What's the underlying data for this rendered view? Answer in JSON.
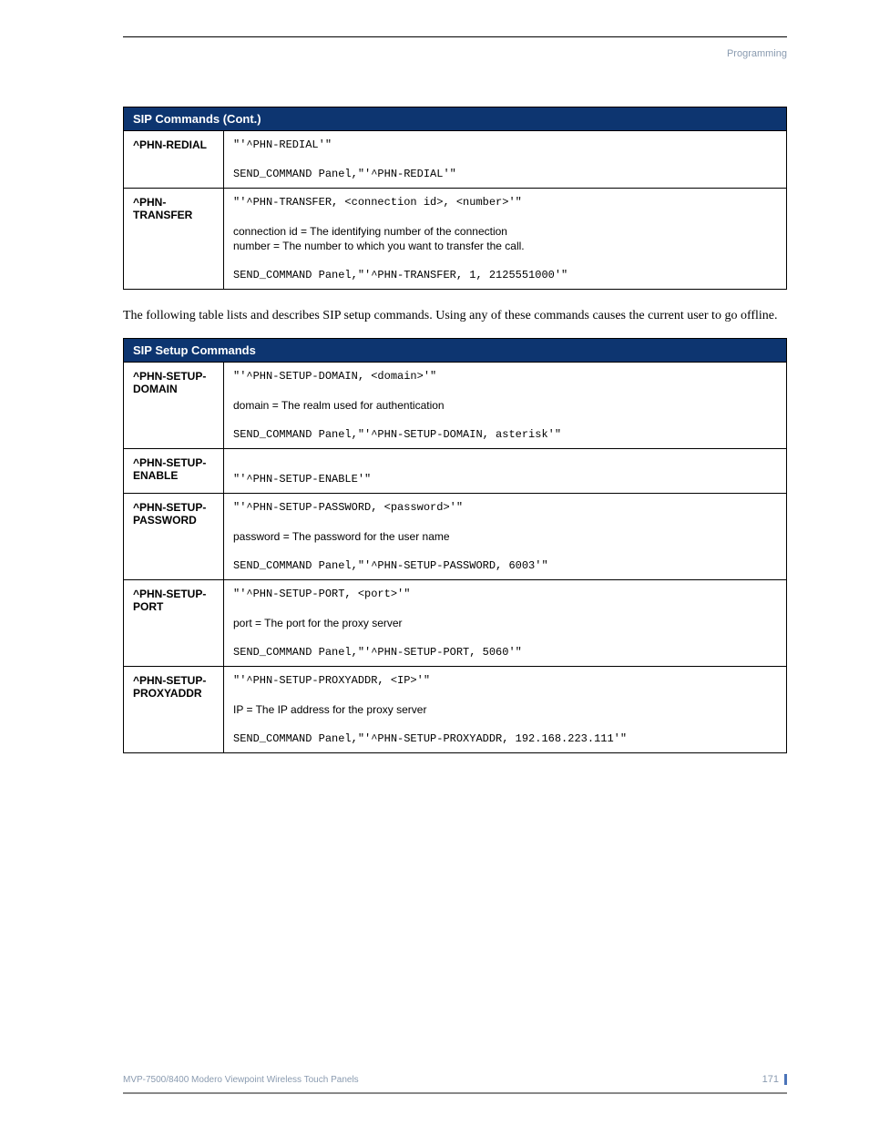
{
  "header": {
    "section": "Programming"
  },
  "table1": {
    "title": "SIP Commands (Cont.)",
    "rows": [
      {
        "name": "^PHN-REDIAL",
        "lines": [
          {
            "text": "\"'^PHN-REDIAL'\"",
            "mono": true
          },
          {
            "text": "SEND_COMMAND Panel,\"'^PHN-REDIAL'\"",
            "mono": true
          }
        ]
      },
      {
        "name": "^PHN-TRANSFER",
        "lines": [
          {
            "text": "\"'^PHN-TRANSFER, <connection id>, <number>'\"",
            "mono": true
          },
          {
            "text": "connection id = The identifying number of the connection",
            "mono": false
          },
          {
            "text": "number = The number to which you want to transfer the call.",
            "mono": false,
            "tight": true
          },
          {
            "text": "SEND_COMMAND Panel,\"'^PHN-TRANSFER, 1, 2125551000'\"",
            "mono": true
          }
        ]
      }
    ]
  },
  "paragraph": "The following table lists and describes SIP setup commands. Using any of these commands causes the current user to go offline.",
  "table2": {
    "title": "SIP Setup Commands",
    "rows": [
      {
        "name": "^PHN-SETUP-DOMAIN",
        "lines": [
          {
            "text": "\"'^PHN-SETUP-DOMAIN, <domain>'\"",
            "mono": true
          },
          {
            "text": "domain = The realm used for authentication",
            "mono": false
          },
          {
            "text": "SEND_COMMAND Panel,\"'^PHN-SETUP-DOMAIN, asterisk'\"",
            "mono": true
          }
        ]
      },
      {
        "name": "^PHN-SETUP-ENABLE",
        "lines": [
          {
            "text": " ",
            "mono": false
          },
          {
            "text": "\"'^PHN-SETUP-ENABLE'\"",
            "mono": true
          }
        ]
      },
      {
        "name": "^PHN-SETUP-PASSWORD",
        "lines": [
          {
            "text": "\"'^PHN-SETUP-PASSWORD, <password>'\"",
            "mono": true
          },
          {
            "text": "password = The password for the user name",
            "mono": false
          },
          {
            "text": "SEND_COMMAND Panel,\"'^PHN-SETUP-PASSWORD, 6003'\"",
            "mono": true
          }
        ]
      },
      {
        "name": "^PHN-SETUP-PORT",
        "lines": [
          {
            "text": "\"'^PHN-SETUP-PORT, <port>'\"",
            "mono": true
          },
          {
            "text": "port = The port for the proxy server",
            "mono": false
          },
          {
            "text": "SEND_COMMAND Panel,\"'^PHN-SETUP-PORT, 5060'\"",
            "mono": true
          }
        ]
      },
      {
        "name": "^PHN-SETUP-PROXYADDR",
        "lines": [
          {
            "text": "\"'^PHN-SETUP-PROXYADDR, <IP>'\"",
            "mono": true
          },
          {
            "text": "IP = The IP address for the proxy server",
            "mono": false
          },
          {
            "text": "SEND_COMMAND Panel,\"'^PHN-SETUP-PROXYADDR, 192.168.223.111'\"",
            "mono": true
          }
        ]
      }
    ]
  },
  "footer": {
    "doc_title": "MVP-7500/8400 Modero Viewpoint Wireless Touch Panels",
    "page_number": "171"
  }
}
